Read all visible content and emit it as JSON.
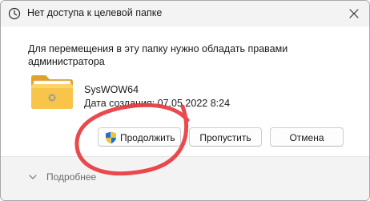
{
  "window": {
    "title": "Нет доступа к целевой папке",
    "title_icon": "clock-icon",
    "close_icon": "close-icon"
  },
  "message": "Для перемещения в эту папку нужно обладать правами администратора",
  "item": {
    "icon": "folder-icon",
    "name": "SysWOW64",
    "date": "Дата создания: 07.05.2022 8:24"
  },
  "buttons": {
    "continue_label": "Продолжить",
    "continue_icon": "uac-shield-icon",
    "skip_label": "Пропустить",
    "cancel_label": "Отмена"
  },
  "footer": {
    "details_label": "Подробнее",
    "details_icon": "chevron-down-icon"
  },
  "colors": {
    "titlebar_bg": "#f3f3f3",
    "footer_bg": "#f3f3f3",
    "folder_yellow": "#f8c54a",
    "annotation_red": "#e8393f"
  }
}
